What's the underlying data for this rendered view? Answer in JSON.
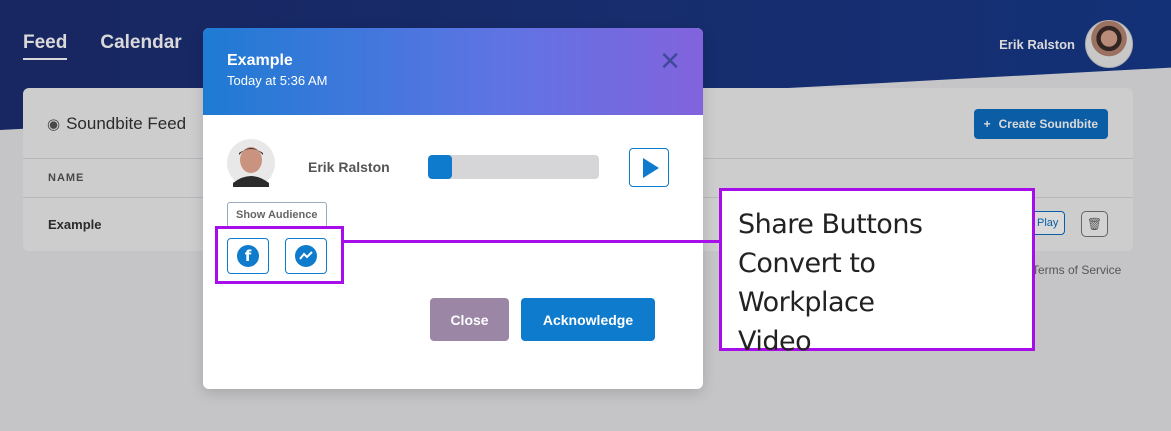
{
  "nav": {
    "items": [
      "Feed",
      "Calendar"
    ],
    "active": "Feed"
  },
  "user": {
    "name": "Erik Ralston"
  },
  "feed": {
    "title": "Soundbite Feed",
    "create_label": "Create Soundbite",
    "column_name": "NAME",
    "rows": [
      {
        "name": "Example",
        "play_label": "Play"
      }
    ]
  },
  "footer": {
    "terms": "Terms of Service"
  },
  "modal": {
    "title": "Example",
    "time": "Today at 5:36 AM",
    "author": "Erik Ralston",
    "progress": 0.14,
    "show_audience_label": "Show Audience",
    "close_label": "Close",
    "acknowledge_label": "Acknowledge"
  },
  "callout": {
    "lines": [
      "Share Buttons",
      "Convert to Workplace",
      "Video"
    ]
  },
  "colors": {
    "accent": "#0f7bcd",
    "highlight": "#a60de8"
  },
  "icons": [
    "podcast-icon",
    "plus-icon",
    "trash-icon",
    "close-icon",
    "play-icon",
    "facebook-icon",
    "messenger-icon"
  ]
}
